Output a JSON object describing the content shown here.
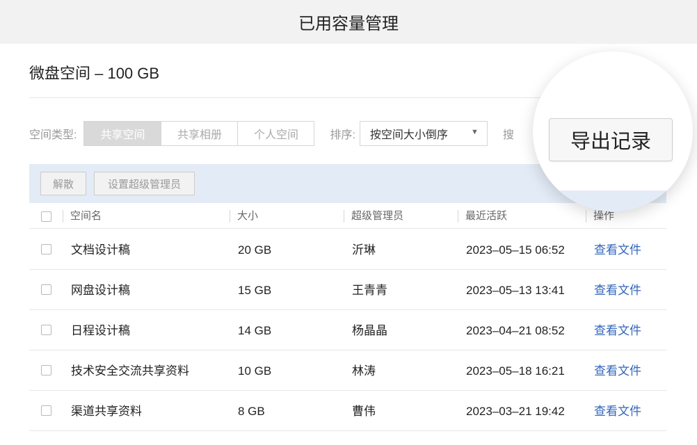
{
  "window": {
    "title": "已用容量管理"
  },
  "space": {
    "title": "微盘空间 – 100 GB"
  },
  "filters": {
    "type_label": "空间类型:",
    "type_options": [
      "共享空间",
      "共享相册",
      "个人空间"
    ],
    "sort_label": "排序:",
    "sort_value": "按空间大小倒序",
    "search_label": "搜"
  },
  "toolbar": {
    "dissolve_label": "解散",
    "set_admin_label": "设置超级管理员",
    "export_label": "导出记录"
  },
  "table": {
    "headers": {
      "name": "空间名",
      "size": "大小",
      "admin": "超级管理员",
      "active": "最近活跃",
      "action": "操作"
    },
    "rows": [
      {
        "name": "文档设计稿",
        "size": "20 GB",
        "admin": "沂琳",
        "active": "2023–05–15 06:52",
        "action": "查看文件"
      },
      {
        "name": "网盘设计稿",
        "size": "15 GB",
        "admin": "王青青",
        "active": "2023–05–13 13:41",
        "action": "查看文件"
      },
      {
        "name": "日程设计稿",
        "size": "14 GB",
        "admin": "杨晶晶",
        "active": "2023–04–21 08:52",
        "action": "查看文件"
      },
      {
        "name": "技术安全交流共享资料",
        "size": "10 GB",
        "admin": "林涛",
        "active": "2023–05–18 16:21",
        "action": "查看文件"
      },
      {
        "name": "渠道共享资料",
        "size": "8 GB",
        "admin": "曹伟",
        "active": "2023–03–21 19:42",
        "action": "查看文件"
      }
    ]
  },
  "colors": {
    "link": "#3366bb",
    "action_bar": "#e3ebf6",
    "title_bar": "#f2f2f2"
  }
}
